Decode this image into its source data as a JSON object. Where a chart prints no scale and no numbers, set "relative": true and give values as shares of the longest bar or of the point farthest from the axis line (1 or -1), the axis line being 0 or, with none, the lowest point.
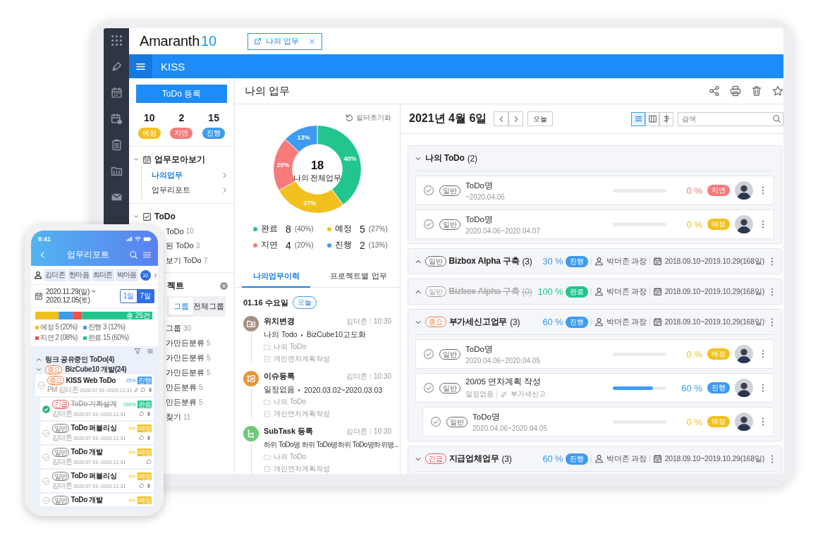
{
  "tablet": {
    "logo": {
      "name": "Amaranth",
      "version": "10"
    },
    "open_tab": {
      "label": "나의 업무"
    },
    "header": {
      "title": "KISS"
    },
    "sidebar": {
      "register_button": "ToDo 등록",
      "counts": [
        {
          "value": "10",
          "label": "예정",
          "color": "#f2c01e"
        },
        {
          "value": "2",
          "label": "지연",
          "color": "#f77b7b"
        },
        {
          "value": "15",
          "label": "진행",
          "color": "#3d9bf0"
        }
      ],
      "sections": [
        {
          "kind": "folder",
          "title": "업무모아보기",
          "expanded": true,
          "items": [
            {
              "label": "나의업무",
              "selected": true
            },
            {
              "label": "업무리포트",
              "selected": false
            }
          ]
        },
        {
          "kind": "todo",
          "title": "ToDo",
          "expanded": true,
          "items": [
            {
              "label": "ToDo",
              "count": "10"
            },
            {
              "label": "된 ToDo",
              "count": "3"
            },
            {
              "label": "보기 ToDo",
              "count": "7"
            }
          ]
        }
      ],
      "project": {
        "title": "젝트",
        "tabs": [
          {
            "label": "그룹",
            "selected": true
          },
          {
            "label": "전체그룹",
            "selected": false
          }
        ],
        "items": [
          {
            "label": "그룹",
            "count": "30"
          },
          {
            "label": "가만든분류",
            "count": "5"
          },
          {
            "label": "가만든분류",
            "count": "5"
          },
          {
            "label": "가만든분류",
            "count": "5"
          },
          {
            "label": "만든분류",
            "count": "5"
          },
          {
            "label": "만든분류",
            "count": "5"
          },
          {
            "label": "찾기",
            "count": "11"
          }
        ]
      }
    },
    "main": {
      "title": "나의 업무",
      "overview": {
        "filter_reset": "필터초기화",
        "chart_data": {
          "type": "donut",
          "categories": [
            "완료",
            "예정",
            "지연",
            "진행"
          ],
          "series": [
            {
              "name": "나의 전체업무",
              "values": [
                40,
                27,
                20,
                13
              ]
            }
          ],
          "value_labels": [
            "40%",
            "27%",
            "20%",
            "13%"
          ]
        },
        "total": "18",
        "legend": [
          {
            "count": "8",
            "percent": "(40%)",
            "color": "#22c58e"
          },
          {
            "count": "5",
            "percent": "(27%)",
            "color": "#f2c01e"
          },
          {
            "count": "4",
            "percent": "(20%)",
            "color": "#f77b7b"
          },
          {
            "count": "2",
            "percent": "(13%)",
            "color": "#3d9bf0"
          }
        ],
        "tabs": [
          {
            "label": "나의업무이력",
            "selected": true
          },
          {
            "label": "프로젝트별 업무",
            "selected": false
          }
        ],
        "history": {
          "date": "01.16 수요일",
          "badge": "오늘",
          "entries": [
            {
              "kind": "move",
              "color": "#a58f86",
              "title": "위치변경",
              "author": "김더존",
              "time": "10:30",
              "from": "나의 Todo",
              "to": "BizCube10고도화",
              "folder": "나의 ToDo",
              "task": "개인연차계획작성"
            },
            {
              "kind": "issue",
              "color": "#e8953a",
              "title": "이슈등록",
              "author": "김더존",
              "time": "10:30",
              "from": "일정없음",
              "to": "2020.03.02~2020.03.03",
              "folder": "나의 ToDo",
              "task": "개인연차계획작성"
            },
            {
              "kind": "subtask",
              "color": "#6cc97a",
              "title": "SubTask 등록",
              "author": "김더존",
              "time": "10:30",
              "text": "하위 ToDo명 하위 ToDo명하위 ToDo명하위명...",
              "folder": "나의 ToDo",
              "task": "개인연차계획작성"
            }
          ]
        }
      },
      "schedule": {
        "date": "2021년 4월 6일",
        "today_button": "오늘",
        "views": [
          {
            "kind": "list",
            "selected": true
          },
          {
            "kind": "columns",
            "selected": false
          },
          {
            "kind": "gantt",
            "selected": false
          }
        ],
        "search": {
          "placeholder": "검색"
        },
        "groups": [
          {
            "kind": "personal",
            "title": "나의 ToDo",
            "count": "(2)",
            "expanded": true,
            "todos": [
              {
                "tag": {
                  "label": "일반",
                  "color": "#666666"
                },
                "title": "ToDo명",
                "period": "~2020.04.05",
                "level": 0,
                "percent": "0 %",
                "status": {
                  "label": "지연",
                  "color": "#f77b7b"
                }
              },
              {
                "tag": {
                  "label": "일반",
                  "color": "#666666"
                },
                "title": "ToDo명",
                "period": "2020.04.06~2020.04.07",
                "level": 0,
                "percent": "0 %",
                "status": {
                  "label": "예정",
                  "color": "#f2c01e"
                }
              }
            ]
          },
          {
            "kind": "project",
            "tag": {
              "label": "일반",
              "color": "#666666"
            },
            "title": "Bizbox Alpha 구축",
            "count": "(3)",
            "expanded": false,
            "done": false,
            "percent": "30 %",
            "status": {
              "label": "진행",
              "color": "#3d9bf0"
            },
            "owner": "박더존 과장",
            "period": "2018.09.10~2019.10.29(168일)"
          },
          {
            "kind": "project",
            "tag": {
              "label": "일반",
              "color": "#999999"
            },
            "title": "Bizbox Alpha 구축",
            "count": "(0)",
            "expanded": false,
            "done": true,
            "percent": "100 %",
            "status": {
              "label": "완료",
              "color": "#22c58e"
            },
            "owner": "박더존 과장",
            "period": "2018.09.10~2019.10.29(168일)"
          },
          {
            "kind": "project",
            "tag": {
              "label": "중요",
              "color": "#f07a3a"
            },
            "title": "부가세신고업무",
            "count": "(3)",
            "expanded": true,
            "done": false,
            "percent": "60 %",
            "status": {
              "label": "진행",
              "color": "#3d9bf0"
            },
            "owner": "박더존 과장",
            "period": "2018.09.10~2019.10.29(168일)",
            "todos": [
              {
                "tag": {
                  "label": "일반",
                  "color": "#666666"
                },
                "title": "ToDo명",
                "period": "2020.04.06~2020.04.05",
                "level": 0,
                "percent": "0 %",
                "status": {
                  "label": "예정",
                  "color": "#f2c01e"
                }
              },
              {
                "tag": {
                  "label": "일반",
                  "color": "#666666"
                },
                "title": "20/05 연차계획 작성",
                "period": "일정없음",
                "link": "부가세신고",
                "level": 0.75,
                "percent": "60 %",
                "status": {
                  "label": "진행",
                  "color": "#3d9bf0"
                },
                "children": [
                  {
                    "tag": {
                      "label": "일반",
                      "color": "#666666"
                    },
                    "title": "ToDo명",
                    "period": "2020.04.06~2020.04.05",
                    "level": 0,
                    "percent": "0 %",
                    "status": {
                      "label": "예정",
                      "color": "#f2c01e"
                    }
                  }
                ]
              }
            ]
          },
          {
            "kind": "project",
            "tag": {
              "label": "긴급",
              "color": "#f0505a"
            },
            "title": "지급업체업무",
            "count": "(3)",
            "expanded": true,
            "done": false,
            "percent": "60 %",
            "status": {
              "label": "진행",
              "color": "#3d9bf0"
            },
            "owner": "박더존 과장",
            "period": "2018.09.10~2019.10.29(168일)"
          }
        ]
      }
    }
  },
  "phone": {
    "time": "9:41",
    "title": "업무리포트",
    "people": [
      {
        "name": "김더존"
      },
      {
        "name": "한마음"
      },
      {
        "name": "최더존"
      },
      {
        "name": "박마음"
      }
    ],
    "people_count": "10",
    "period": "2020.11.29(일) ~ 2020.12.05(토)",
    "ranges": [
      {
        "label": "1일",
        "selected": false
      },
      {
        "label": "7일",
        "selected": true
      }
    ],
    "summary": {
      "total": "총 25건",
      "chart_data": {
        "type": "bar",
        "orientation": "horizontal",
        "stacked": true,
        "relative": true,
        "series": [
          {
            "name": "예정 5 (20%)",
            "color": "#f2c01e",
            "values": [
              0.2
            ]
          },
          {
            "name": "진행 3 (12%)",
            "color": "#3d9bf0",
            "values": [
              0.12
            ]
          },
          {
            "name": "지연 2 (08%)",
            "color": "#f05050",
            "values": [
              0.08
            ]
          },
          {
            "name": "완료 15 (60%)",
            "color": "#22c58e",
            "values": [
              0.6
            ]
          }
        ]
      }
    },
    "shared": {
      "title": "링크 공유중인 ToDo(4)",
      "expanded": false
    },
    "project": {
      "tag": {
        "label": "중요",
        "color": "#f07a3a"
      },
      "title": "BizCube10 개발(24)",
      "expanded": true
    },
    "todos": [
      {
        "tag": {
          "label": "중요",
          "color": "#f07a3a"
        },
        "title": "KISS Web ToDo",
        "owner": "PM 김더존",
        "period": "2020.07.01~2020.12.31",
        "percent": "45%",
        "status": {
          "label": "진행",
          "color": "#3d9bf0"
        },
        "checked": false,
        "done": false,
        "link": true,
        "comment": true,
        "file": true,
        "children": [
          {
            "tag": {
              "label": "긴급",
              "color": "#f05050"
            },
            "title": "ToDo 기획설계",
            "owner": "김더존",
            "period": "2020.07.01~2020.12.31",
            "percent": "100%",
            "status": {
              "label": "완료",
              "color": "#22c58e"
            },
            "checked": true,
            "done": true,
            "link": false,
            "comment": true,
            "file": true
          },
          {
            "tag": {
              "label": "일반",
              "color": "#777777"
            },
            "title": "ToDo 퍼블리싱",
            "owner": "김더존",
            "period": "2020.07.01~2020.12.31",
            "percent": "0%",
            "status": {
              "label": "예정",
              "color": "#f2c01e"
            },
            "checked": false,
            "done": false,
            "link": false,
            "comment": true,
            "file": true
          },
          {
            "tag": {
              "label": "일반",
              "color": "#777777"
            },
            "title": "ToDo 개발",
            "owner": "김더존",
            "period": "2020.07.01~2020.12.31",
            "percent": "0%",
            "status": {
              "label": "예정",
              "color": "#f2c01e"
            },
            "checked": false,
            "done": false,
            "link": false,
            "comment": true,
            "file": false
          },
          {
            "tag": {
              "label": "일반",
              "color": "#777777"
            },
            "title": "ToDo 퍼블리싱",
            "owner": "김더존",
            "period": "2020.07.01~2020.12.31",
            "percent": "0%",
            "status": {
              "label": "예정",
              "color": "#f2c01e"
            },
            "checked": false,
            "done": false,
            "link": false,
            "comment": true,
            "file": true
          },
          {
            "tag": {
              "label": "일반",
              "color": "#777777"
            },
            "title": "ToDo 개발",
            "percent": "0%",
            "status": {
              "label": "예정",
              "color": "#f2c01e"
            },
            "checked": false,
            "done": false
          }
        ]
      }
    ]
  }
}
